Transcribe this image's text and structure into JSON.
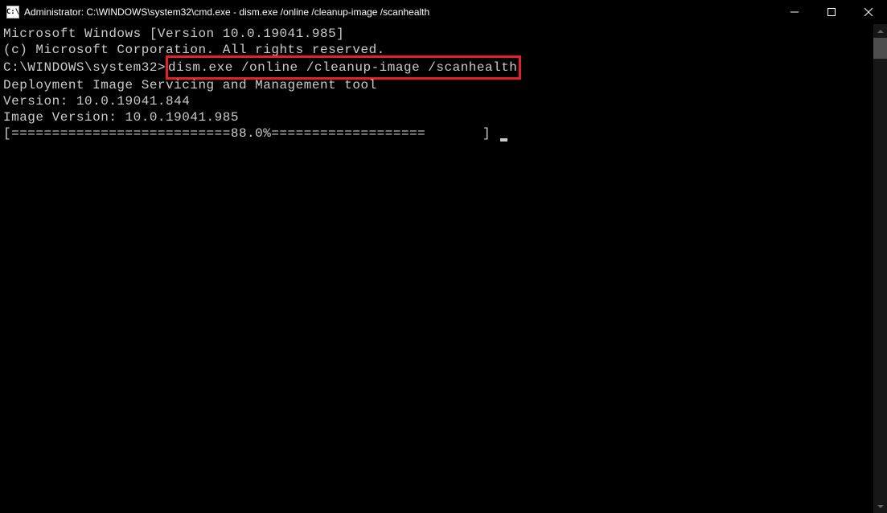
{
  "window": {
    "title": "Administrator: C:\\WINDOWS\\system32\\cmd.exe - dism.exe  /online /cleanup-image /scanhealth",
    "icon_label": "cmd-icon"
  },
  "terminal": {
    "line1": "Microsoft Windows [Version 10.0.19041.985]",
    "line2": "(c) Microsoft Corporation. All rights reserved.",
    "blank1": "",
    "prompt_prefix": "C:\\WINDOWS\\system32>",
    "command": "dism.exe /online /cleanup-image /scanhealth",
    "blank2": "",
    "tool_line": "Deployment Image Servicing and Management tool",
    "tool_version": "Version: 10.0.19041.844",
    "blank3": "",
    "image_version": "Image Version: 10.0.19041.985",
    "blank4": "",
    "progress": "[===========================88.0%===================       ] "
  }
}
